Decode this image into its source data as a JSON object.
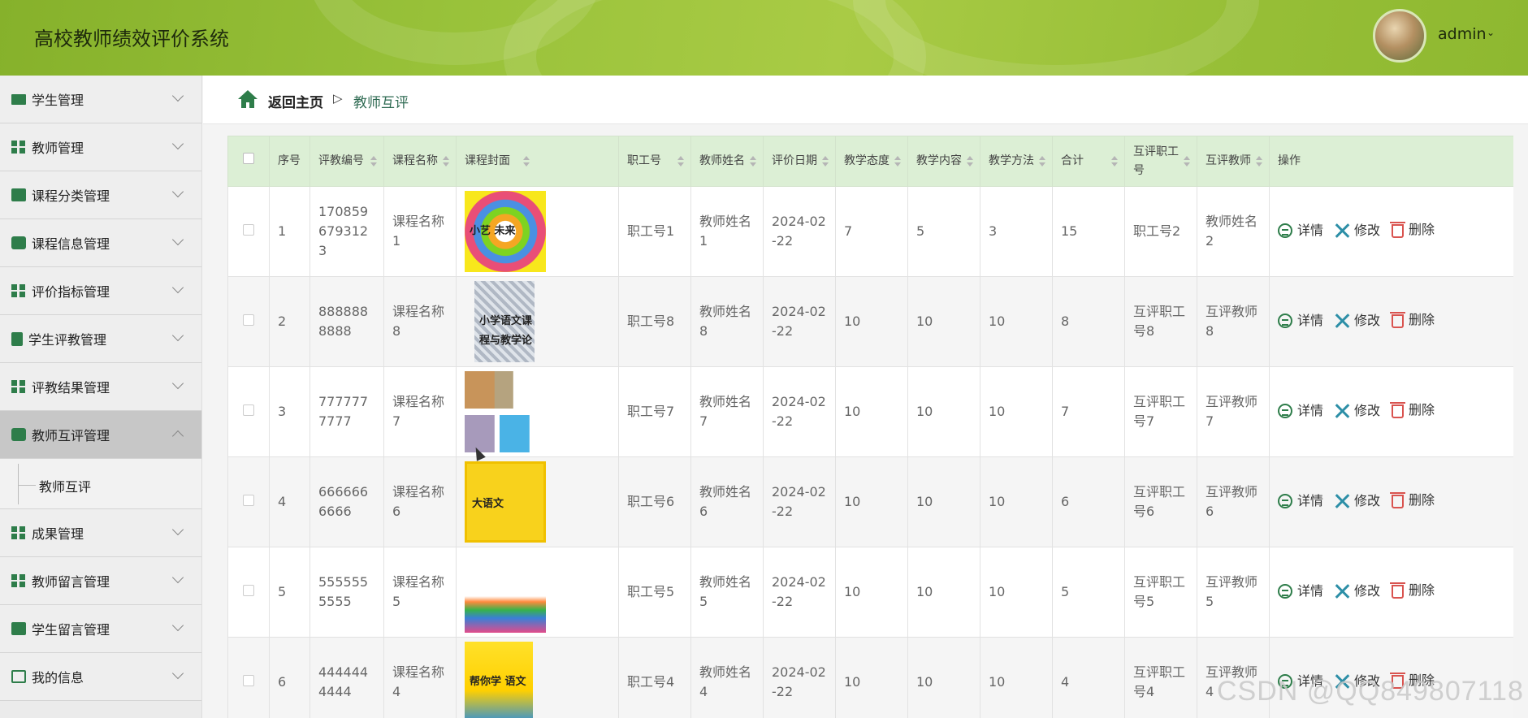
{
  "app": {
    "title": "高校教师绩效评价系统",
    "user": "admin"
  },
  "sidebar": {
    "items": [
      {
        "label": "学生管理",
        "icon": "monitor-icon"
      },
      {
        "label": "教师管理",
        "icon": "grid-icon"
      },
      {
        "label": "课程分类管理",
        "icon": "ticket-icon"
      },
      {
        "label": "课程信息管理",
        "icon": "wallet-icon"
      },
      {
        "label": "评价指标管理",
        "icon": "grid-icon"
      },
      {
        "label": "学生评教管理",
        "icon": "clipboard-icon"
      },
      {
        "label": "评教结果管理",
        "icon": "grid-icon"
      },
      {
        "label": "教师互评管理",
        "icon": "chat-icon",
        "active": true
      },
      {
        "label": "成果管理",
        "icon": "grid-icon"
      },
      {
        "label": "教师留言管理",
        "icon": "grid-icon"
      },
      {
        "label": "学生留言管理",
        "icon": "briefcase-icon"
      },
      {
        "label": "我的信息",
        "icon": "card-icon"
      }
    ],
    "submenu": {
      "label": "教师互评"
    }
  },
  "breadcrumb": {
    "home": "返回主页",
    "separator": "▷",
    "current": "教师互评"
  },
  "table": {
    "headers": [
      "序号",
      "评教编号",
      "课程名称",
      "课程封面",
      "职工号",
      "教师姓名",
      "评价日期",
      "教学态度",
      "教学内容",
      "教学方法",
      "合计",
      "互评职工号",
      "互评教师",
      "操作"
    ],
    "actions": {
      "detail": "详情",
      "edit": "修改",
      "delete": "删除"
    },
    "rows": [
      {
        "idx": "1",
        "code": "1708596793123",
        "course": "课程名称1",
        "staff": "职工号1",
        "teacher": "教师姓名1",
        "date": "2024-02-22",
        "attitude": "7",
        "content": "5",
        "method": "3",
        "total": "15",
        "peer_staff": "职工号2",
        "peer_teacher": "教师姓名2",
        "cover": "cover-colorful",
        "cover_text": "小艺 未来"
      },
      {
        "idx": "2",
        "code": "8888888888",
        "course": "课程名称8",
        "staff": "职工号8",
        "teacher": "教师姓名8",
        "date": "2024-02-22",
        "attitude": "10",
        "content": "10",
        "method": "10",
        "total": "8",
        "peer_staff": "互评职工号8",
        "peer_teacher": "互评教师8",
        "cover": "cover-pattern",
        "cover_text": "小学语文课程与教学论"
      },
      {
        "idx": "3",
        "code": "7777777777",
        "course": "课程名称7",
        "staff": "职工号7",
        "teacher": "教师姓名7",
        "date": "2024-02-22",
        "attitude": "10",
        "content": "10",
        "method": "10",
        "total": "7",
        "peer_staff": "互评职工号7",
        "peer_teacher": "互评教师7",
        "cover": "cover-collage",
        "cover_text": ""
      },
      {
        "idx": "4",
        "code": "6666666666",
        "course": "课程名称6",
        "staff": "职工号6",
        "teacher": "教师姓名6",
        "date": "2024-02-22",
        "attitude": "10",
        "content": "10",
        "method": "10",
        "total": "6",
        "peer_staff": "互评职工号6",
        "peer_teacher": "互评教师6",
        "cover": "cover-yellow",
        "cover_text": "大语文"
      },
      {
        "idx": "5",
        "code": "5555555555",
        "course": "课程名称5",
        "staff": "职工号5",
        "teacher": "教师姓名5",
        "date": "2024-02-22",
        "attitude": "10",
        "content": "10",
        "method": "10",
        "total": "5",
        "peer_staff": "互评职工号5",
        "peer_teacher": "互评教师5",
        "cover": "cover-hands",
        "cover_text": ""
      },
      {
        "idx": "6",
        "code": "4444444444",
        "course": "课程名称4",
        "staff": "职工号4",
        "teacher": "教师姓名4",
        "date": "2024-02-22",
        "attitude": "10",
        "content": "10",
        "method": "10",
        "total": "4",
        "peer_staff": "互评职工号4",
        "peer_teacher": "互评教师4",
        "cover": "cover-yellow2",
        "cover_text": "帮你学 语文"
      }
    ]
  },
  "watermark": "CSDN @QQ849807118",
  "colors": {
    "header": "#9cc23b",
    "accent": "#2e7d4a",
    "table_header": "#dcefd5",
    "delete": "#d9534f"
  }
}
